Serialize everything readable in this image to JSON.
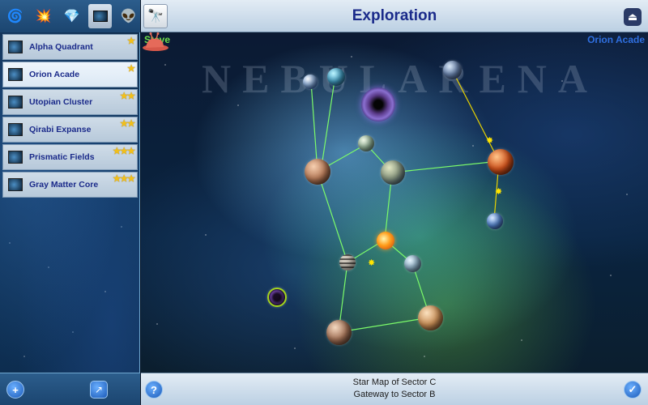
{
  "tabs": [
    {
      "name": "spiral-galaxy-icon",
      "glyph": "🌀"
    },
    {
      "name": "explosion-icon",
      "glyph": "💥"
    },
    {
      "name": "gem-icon",
      "glyph": "💎"
    },
    {
      "name": "star-map-icon",
      "glyph": ""
    },
    {
      "name": "alien-icon",
      "glyph": "👽"
    }
  ],
  "sectors": [
    {
      "label": "Alpha Quadrant",
      "stars": "★"
    },
    {
      "label": "Orion Acade",
      "stars": "★"
    },
    {
      "label": "Utopian Cluster",
      "stars": "★★"
    },
    {
      "label": "Qirabi Expanse",
      "stars": "★★"
    },
    {
      "label": "Prismatic Fields",
      "stars": "★★★"
    },
    {
      "label": "Gray Matter Core",
      "stars": "★★★"
    }
  ],
  "header": {
    "title": "Exploration",
    "scope_glyph": "🔭",
    "exit_glyph": "⏏"
  },
  "map": {
    "watermark": "NEBULARENA",
    "player_left": "Steve",
    "player_right": "Orion Acade"
  },
  "left_footer": {
    "add_glyph": "+",
    "share_glyph": "↗"
  },
  "footer": {
    "help_glyph": "?",
    "line1": "Star Map of Sector C",
    "line2": "Gateway to Sector B",
    "check_glyph": "✓"
  },
  "colors": {
    "title": "#1a2a8a",
    "player_left": "#6fe04a",
    "player_right": "#2f6fe0",
    "link_line": "#7CFC6A",
    "star_rating": "#f2c01a"
  }
}
